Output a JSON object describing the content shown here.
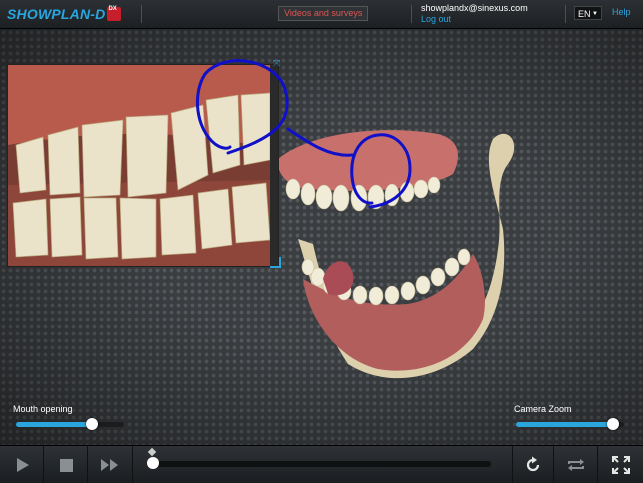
{
  "header": {
    "logo_text": "SHOWPLAN-D",
    "logo_badge": "DX",
    "videos_button": "Videos and surveys",
    "account_email": "showplandx@sinexus.com",
    "logout_label": "Log out",
    "language": "EN",
    "help_label": "Help"
  },
  "viewport": {
    "mouth_opening": {
      "label": "Mouth opening",
      "value": 0.7
    },
    "camera_zoom": {
      "label": "Camera Zoom",
      "value": 0.9
    }
  },
  "controls": {
    "icons": [
      "play-icon",
      "stop-icon",
      "fast-forward-icon",
      "reset-rotation-icon",
      "loop-icon",
      "fullscreen-icon"
    ],
    "timeline_position": 0
  },
  "colors": {
    "accent": "#29a6e0",
    "brand_red": "#c61f2b",
    "videos_text": "#e05454",
    "annotation": "#1010c8"
  }
}
